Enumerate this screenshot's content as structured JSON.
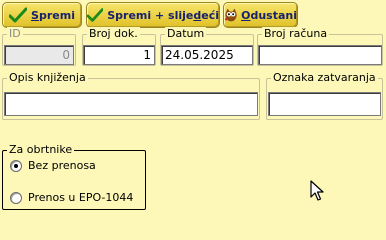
{
  "toolbar": {
    "save": {
      "pre": "",
      "ul": "S",
      "post": "premi"
    },
    "save_next": {
      "pre": "Spremi + slije",
      "ul": "d",
      "post": "eći"
    },
    "cancel": {
      "pre": "",
      "ul": "O",
      "post": "dustani"
    }
  },
  "fields": {
    "id": {
      "label": "ID",
      "value": "0"
    },
    "broj_dok": {
      "label": "Broj dok.",
      "value": "1"
    },
    "datum": {
      "label": "Datum",
      "value": "24.05.2025"
    },
    "broj_racuna": {
      "label": "Broj računa",
      "value": ""
    },
    "opis": {
      "label": "Opis knjiženja",
      "value": ""
    },
    "oznaka": {
      "label": "Oznaka zatvaranja",
      "value": ""
    }
  },
  "obrtnici": {
    "title": "Za obrtnike",
    "options": [
      {
        "label": "Bez prenosa",
        "checked": true
      },
      {
        "label": "Prenos u EPO-1044",
        "checked": false
      }
    ]
  }
}
